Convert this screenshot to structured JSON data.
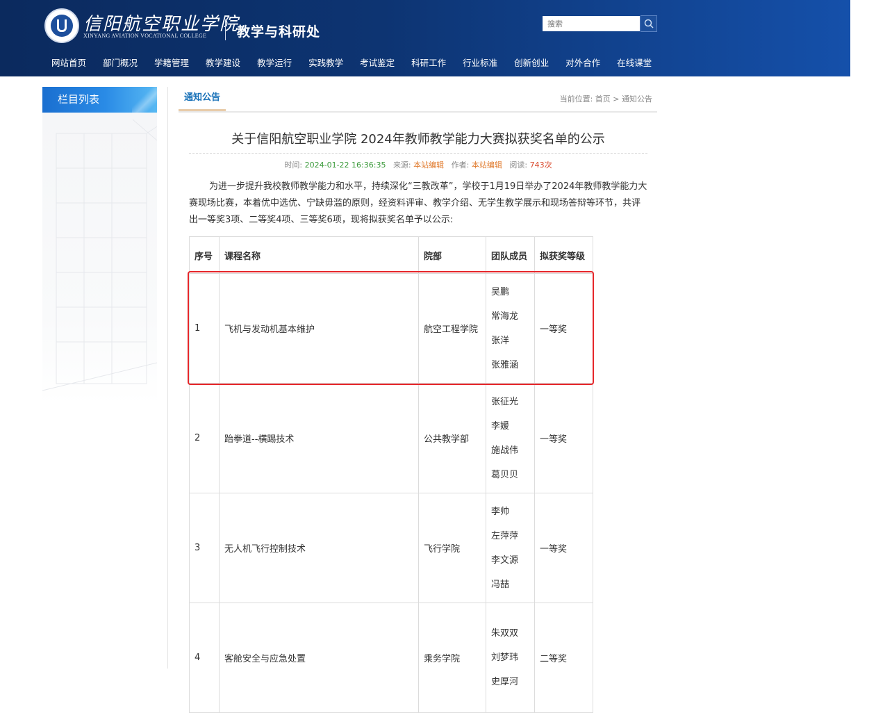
{
  "header": {
    "school_name_cn": "信阳航空职业学院",
    "school_name_en": "XINYANG AVIATION VOCATIONAL COLLEGE",
    "dept_name": "教学与科研处",
    "search_placeholder": "搜索"
  },
  "nav": [
    "网站首页",
    "部门概况",
    "学籍管理",
    "教学建设",
    "教学运行",
    "实践教学",
    "考试鉴定",
    "科研工作",
    "行业标准",
    "创新创业",
    "对外合作",
    "在线课堂"
  ],
  "sidebar": {
    "title": "栏目列表"
  },
  "tab": {
    "label": "通知公告"
  },
  "breadcrumb": "当前位置: 首页 > 通知公告",
  "article": {
    "title": "关于信阳航空职业学院 2024年教师教学能力大赛拟获奖名单的公示",
    "meta": {
      "time_label": "时间:",
      "time": "2024-01-22 16:36:35",
      "source_label": "来源:",
      "source": "本站编辑",
      "author_label": "作者:",
      "author": "本站编辑",
      "reads_label": "阅读:",
      "reads": "743次"
    },
    "body": "为进一步提升我校教师教学能力和水平，持续深化“三教改革”，学校于1月19日举办了2024年教师教学能力大赛现场比赛，本着优中选优、宁缺毋滥的原则，经资料评审、教学介绍、无学生教学展示和现场答辩等环节，共评出一等奖3项、二等奖4项、三等奖6项，现将拟获奖名单予以公示:"
  },
  "table": {
    "headers": [
      "序号",
      "课程名称",
      "院部",
      "团队成员",
      "拟获奖等级"
    ],
    "rows": [
      {
        "no": "1",
        "course": "飞机与发动机基本维护",
        "dept": "航空工程学院",
        "members": [
          "吴鹏",
          "常海龙",
          "张洋",
          "张雅涵"
        ],
        "award": "一等奖"
      },
      {
        "no": "2",
        "course": "跆拳道--横踢技术",
        "dept": "公共教学部",
        "members": [
          "张征光",
          "李媛",
          "施战伟",
          "葛贝贝"
        ],
        "award": "一等奖"
      },
      {
        "no": "3",
        "course": "无人机飞行控制技术",
        "dept": "飞行学院",
        "members": [
          "李帅",
          "左萍萍",
          "李文源",
          "冯喆"
        ],
        "award": "一等奖"
      },
      {
        "no": "4",
        "course": "客舱安全与应急处置",
        "dept": "乘务学院",
        "members": [
          "朱双双",
          "刘梦玮",
          "史厚河"
        ],
        "award": "二等奖"
      }
    ]
  }
}
